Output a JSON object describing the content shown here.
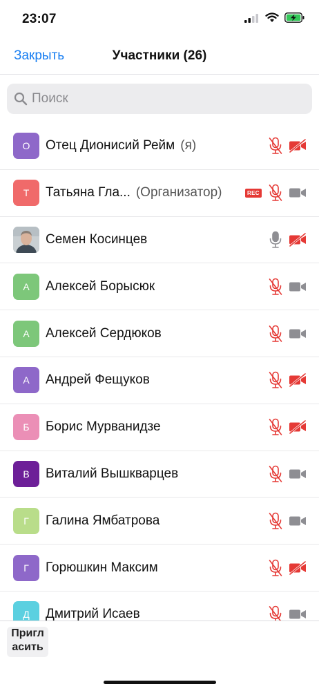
{
  "status_bar": {
    "time": "23:07"
  },
  "nav": {
    "close_label": "Закрыть",
    "title": "Участники (26)"
  },
  "search": {
    "placeholder": "Поиск"
  },
  "colors": {
    "accent": "#1a7ff2",
    "muted_red": "#e53935",
    "icon_gray": "#8e8e93"
  },
  "participants": [
    {
      "initial": "О",
      "avatar_color": "#8e68c9",
      "name": "Отец Дионисий Рейм",
      "role": "(я)",
      "rec": false,
      "mic": "muted",
      "video": "off"
    },
    {
      "initial": "Т",
      "avatar_color": "#f06a6a",
      "name": "Татьяна Гла...",
      "role": "(Организатор)",
      "rec": true,
      "rec_label": "REC",
      "mic": "muted",
      "video": "on"
    },
    {
      "initial": "",
      "avatar_color": "#9aa3a8",
      "photo": true,
      "name": "Семен Косинцев",
      "role": "",
      "rec": false,
      "mic": "on",
      "video": "off"
    },
    {
      "initial": "А",
      "avatar_color": "#7dc77a",
      "name": "Алексей Борысюк",
      "role": "",
      "rec": false,
      "mic": "muted",
      "video": "on"
    },
    {
      "initial": "А",
      "avatar_color": "#7dc77a",
      "name": "Алексей Сердюков",
      "role": "",
      "rec": false,
      "mic": "muted",
      "video": "on"
    },
    {
      "initial": "А",
      "avatar_color": "#8e68c9",
      "name": "Андрей Фещуков",
      "role": "",
      "rec": false,
      "mic": "muted",
      "video": "off"
    },
    {
      "initial": "Б",
      "avatar_color": "#eb8fb6",
      "name": "Борис Мурванидзе",
      "role": "",
      "rec": false,
      "mic": "muted",
      "video": "off"
    },
    {
      "initial": "В",
      "avatar_color": "#6d1f98",
      "name": "Виталий Вышкварцев",
      "role": "",
      "rec": false,
      "mic": "muted",
      "video": "on"
    },
    {
      "initial": "Г",
      "avatar_color": "#b9dd8a",
      "name": "Галина Ямбатрова",
      "role": "",
      "rec": false,
      "mic": "muted",
      "video": "on"
    },
    {
      "initial": "Г",
      "avatar_color": "#8e68c9",
      "name": "Горюшкин Максим",
      "role": "",
      "rec": false,
      "mic": "muted",
      "video": "off"
    },
    {
      "initial": "Д",
      "avatar_color": "#5bd0e0",
      "name": "Дмитрий Исаев",
      "role": "",
      "rec": false,
      "mic": "muted",
      "video": "on"
    }
  ],
  "bottom": {
    "invite_line1": "Пригл",
    "invite_line2": "асить"
  }
}
